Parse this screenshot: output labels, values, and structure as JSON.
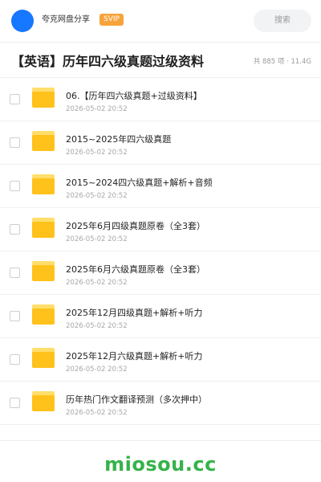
{
  "header": {
    "share_name": "夸克网盘分享",
    "vip_badge": "SVIP",
    "search_label": "搜索"
  },
  "folder": {
    "title": "【英语】历年四六级真题过级资料",
    "meta": "共 885 项 · 11.4G"
  },
  "items": [
    {
      "name": "06.【历年四六级真题+过级资料】",
      "date": "2026-05-02 20:52",
      "icon": "folder-icon"
    },
    {
      "name": "2015~2025年四六级真题",
      "date": "2026-05-02 20:52",
      "icon": "folder-icon"
    },
    {
      "name": "2015~2024四六级真题+解析+音频",
      "date": "2026-05-02 20:52",
      "icon": "folder-icon"
    },
    {
      "name": "2025年6月四级真题原卷（全3套）",
      "date": "2026-05-02 20:52",
      "icon": "folder-icon"
    },
    {
      "name": "2025年6月六级真题原卷（全3套）",
      "date": "2026-05-02 20:52",
      "icon": "folder-icon"
    },
    {
      "name": "2025年12月四级真题+解析+听力",
      "date": "2026-05-02 20:52",
      "icon": "folder-icon"
    },
    {
      "name": "2025年12月六级真题+解析+听力",
      "date": "2026-05-02 20:52",
      "icon": "folder-icon"
    },
    {
      "name": "历年热门作文翻译预测（多次押中）",
      "date": "2026-05-02 20:52",
      "icon": "folder-icon"
    }
  ],
  "watermark": "miosou.cc",
  "colors": {
    "avatar": "#1677ff",
    "vip": "#f7a33b",
    "folder": "#ffc21c",
    "watermark": "#35b34a"
  }
}
